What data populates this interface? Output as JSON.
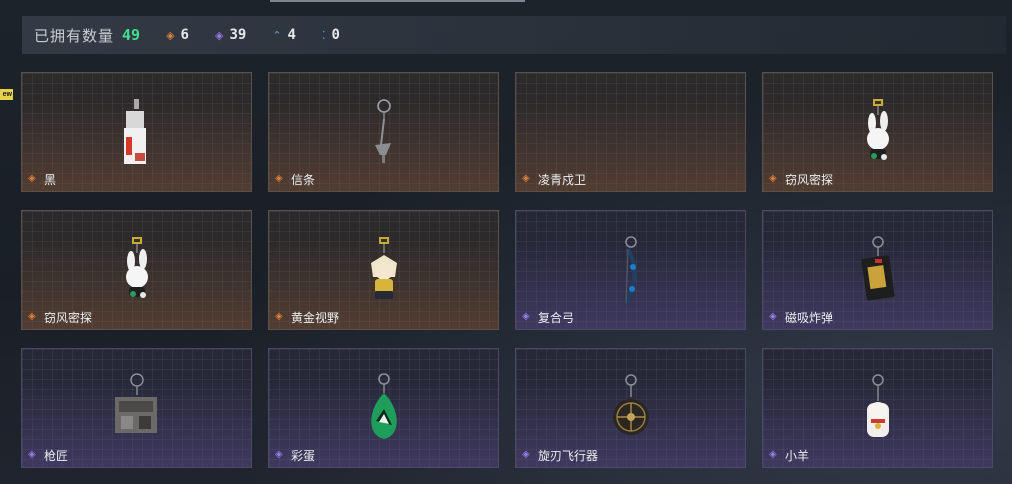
{
  "summary": {
    "label": "已拥有数量",
    "total": "49",
    "rarity_counts": [
      {
        "icon": "orange-diamond-icon",
        "glyph": "◈",
        "color": "#e0813c",
        "count": "6"
      },
      {
        "icon": "purple-diamond-icon",
        "glyph": "◈",
        "color": "#9a7de6",
        "count": "39"
      },
      {
        "icon": "blue-chevron-icon",
        "glyph": "⌃",
        "color": "#5aa2e6",
        "count": "4"
      },
      {
        "icon": "teal-dots-icon",
        "glyph": "⁚",
        "color": "#36c2bc",
        "count": "0"
      }
    ]
  },
  "badge": {
    "new_label": "ew"
  },
  "items": [
    {
      "name": "黑",
      "rarity": "orange",
      "icon": "black-tag-charm-icon"
    },
    {
      "name": "信条",
      "rarity": "orange",
      "icon": "hook-keychain-charm-icon"
    },
    {
      "name": "凌青戍卫",
      "rarity": "orange",
      "icon": "empty-slot-icon"
    },
    {
      "name": "窃风密探",
      "rarity": "orange",
      "icon": "white-rabbit-charm-icon"
    },
    {
      "name": "窃风密探",
      "rarity": "orange",
      "icon": "white-rabbit-charm-icon"
    },
    {
      "name": "黄金视野",
      "rarity": "orange",
      "icon": "blonde-figure-charm-icon"
    },
    {
      "name": "复合弓",
      "rarity": "purple",
      "icon": "compound-bow-charm-icon"
    },
    {
      "name": "磁吸炸弹",
      "rarity": "purple",
      "icon": "magnetic-bomb-charm-icon"
    },
    {
      "name": "枪匠",
      "rarity": "purple",
      "icon": "gunsmith-box-charm-icon"
    },
    {
      "name": "彩蛋",
      "rarity": "purple",
      "icon": "green-egg-charm-icon"
    },
    {
      "name": "旋刃飞行器",
      "rarity": "purple",
      "icon": "blade-drone-charm-icon"
    },
    {
      "name": "小羊",
      "rarity": "purple",
      "icon": "lucky-cat-charm-icon"
    }
  ],
  "colors": {
    "total_green": "#3ee08a",
    "orange_rarity": "#e0813c",
    "purple_rarity": "#9a7de6"
  }
}
